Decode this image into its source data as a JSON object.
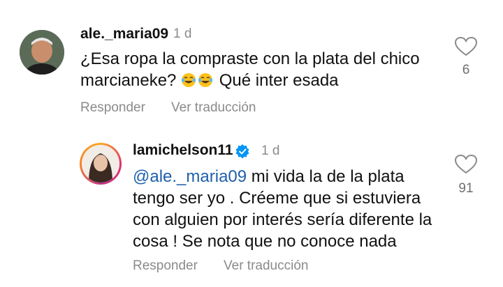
{
  "comments": [
    {
      "username": "ale._maria09",
      "time": "1 d",
      "text_parts": {
        "line1": "¿Esa ropa la compraste con la plata del chico",
        "line2_before": "marcianeke?",
        "emoji_a": "😂",
        "emoji_b": "😂",
        "line2_after": "Qué inter esada"
      },
      "actions": {
        "reply": "Responder",
        "translate": "Ver traducción"
      },
      "likes": "6",
      "icons": {
        "avatar": "avatar-photo",
        "like": "heart-outline-icon"
      }
    },
    {
      "username": "lamichelson11",
      "verified": true,
      "time": "1 d",
      "text_parts": {
        "mention": "@ale._maria09",
        "line1_rest": " mi vida la de la plata",
        "line2": "tengo ser yo . Créeme que si estuviera",
        "line3": "con alguien por interés sería diferente la",
        "line4": "cosa ! Se nota que no conoce nada"
      },
      "actions": {
        "reply": "Responder",
        "translate": "Ver traducción"
      },
      "likes": "91",
      "icons": {
        "avatar": "avatar-photo-story-ring",
        "verified": "verified-badge-icon",
        "like": "heart-outline-icon"
      }
    }
  ],
  "colors": {
    "mention": "#1f5faa",
    "secondary_text": "#8a8a8a",
    "verified": "#0095f6"
  }
}
